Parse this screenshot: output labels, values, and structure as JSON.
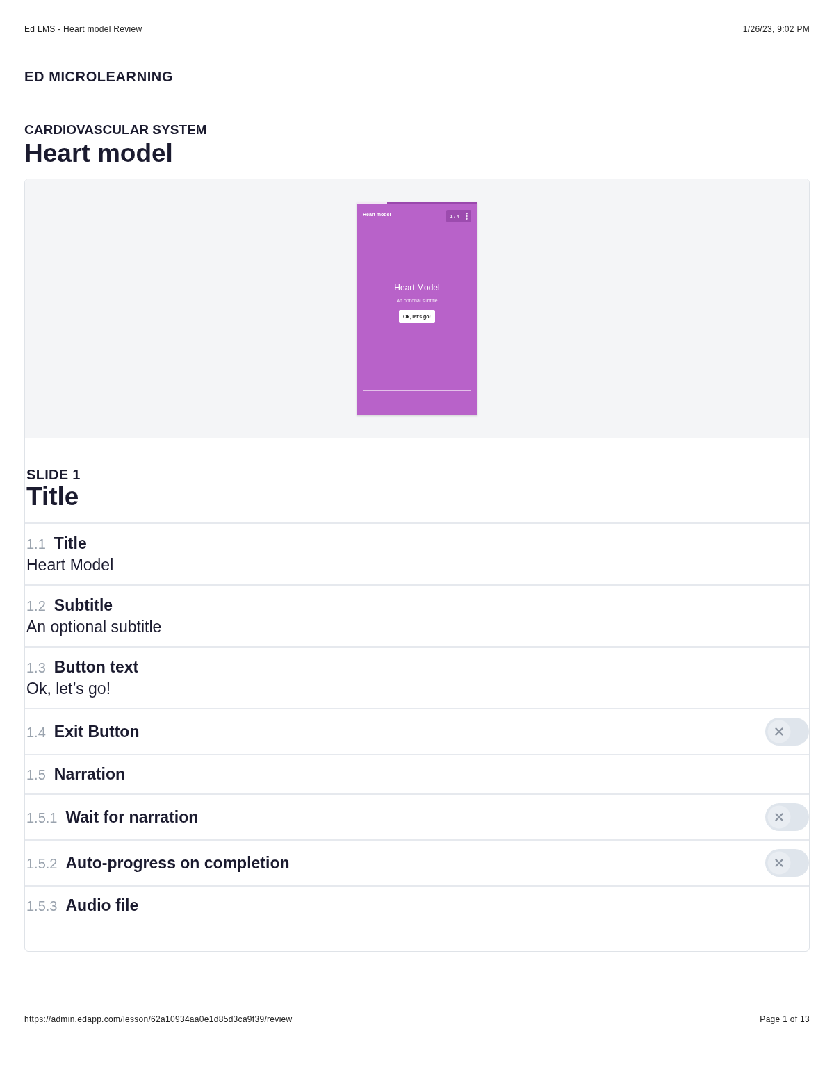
{
  "print_header": {
    "title": "Ed LMS - Heart model Review",
    "date": "1/26/23, 9:02 PM"
  },
  "brand": "ED MICROLEARNING",
  "lesson": {
    "course": "CARDIOVASCULAR SYSTEM",
    "title": "Heart model"
  },
  "preview": {
    "header_title": "Heart model",
    "counter": "1 / 4",
    "progress": {
      "level": 0.25
    },
    "title": "Heart Model",
    "subtitle": "An optional subtitle",
    "button": "Ok, let’s go!"
  },
  "slide": {
    "label": "SLIDE 1",
    "title": "Title"
  },
  "fields": [
    {
      "kind": "text",
      "number": "1.1",
      "label": "Title",
      "value": "Heart Model"
    },
    {
      "kind": "text",
      "number": "1.2",
      "label": "Subtitle",
      "value": "An optional subtitle"
    },
    {
      "kind": "text",
      "number": "1.3",
      "label": "Button text",
      "value": "Ok, let’s go!"
    },
    {
      "kind": "toggle",
      "number": "1.4",
      "label": "Exit Button",
      "on": false
    },
    {
      "kind": "heading",
      "number": "1.5",
      "label": "Narration"
    },
    {
      "kind": "toggle",
      "number": "1.5.1",
      "label": "Wait for narration",
      "on": false
    },
    {
      "kind": "toggle",
      "number": "1.5.2",
      "label": "Auto-progress on completion",
      "on": false
    },
    {
      "kind": "heading",
      "number": "1.5.3",
      "label": "Audio file"
    }
  ],
  "print_footer": {
    "url": "https://admin.edapp.com/lesson/62a10934aa0e1d85d3ca9f39/review",
    "page": "Page 1 of 13"
  }
}
